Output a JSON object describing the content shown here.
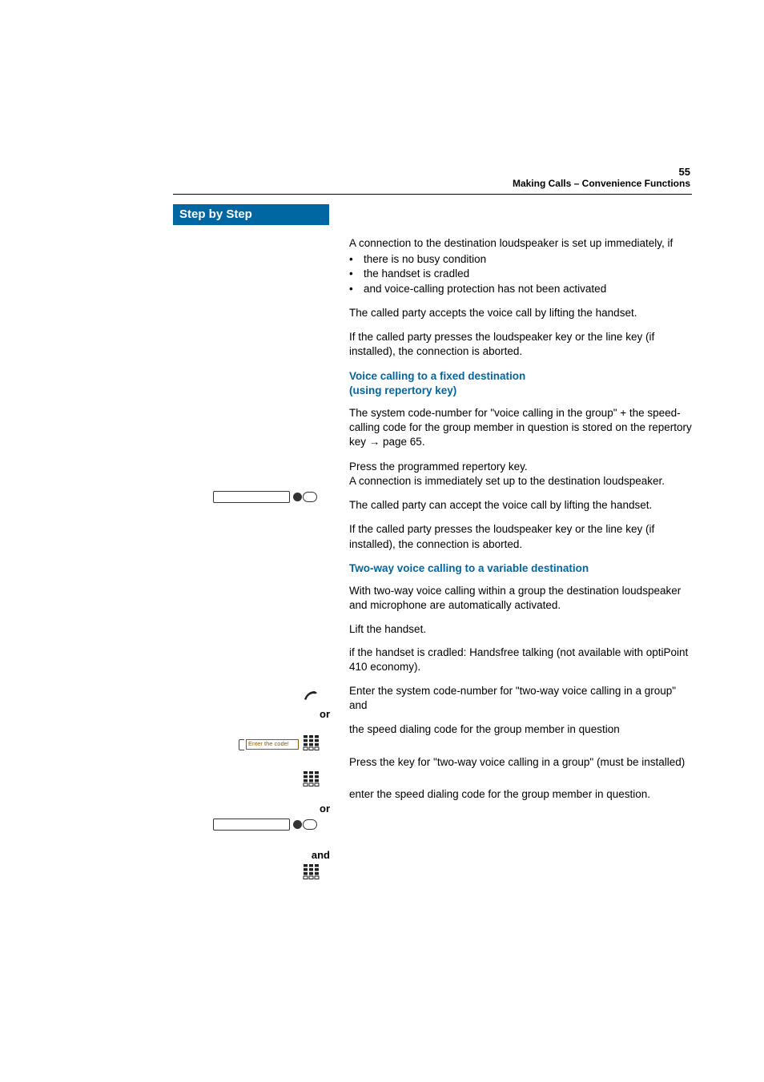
{
  "header": {
    "running_title": "Making Calls – Convenience Functions"
  },
  "sidebar": {
    "title": "Step by Step"
  },
  "intro": {
    "lead": "A connection to the destination loudspeaker is set up immediately, if",
    "bullets": [
      "there is no busy condition",
      "the handset is cradled",
      "and voice-calling protection has not been activated"
    ],
    "p2": "The called party accepts the voice call by lifting the handset.",
    "p3": "If the called party presses the loudspeaker key or the line key (if installed), the connection is aborted."
  },
  "section1": {
    "title_l1": "Voice calling to a fixed destination",
    "title_l2": "(using repertory key)",
    "p1_a": "The system code-number for \"voice calling in the group\" + the speed-calling code for the group member in question is stored on the repertory key ",
    "p1_link": "→ page 65",
    "p1_b": ".",
    "p2": "Press the programmed repertory key.\nA connection is immediately set up to the destination loudspeaker.",
    "p3": "The called party can accept the voice call by lifting the handset.",
    "p4": "If the called party presses the loudspeaker key or the line key (if installed), the connection is aborted."
  },
  "section2": {
    "title": "Two-way voice calling to a variable destination",
    "p1": "With two-way voice calling within a group the destination loudspeaker and microphone are automatically activated.",
    "lift": "Lift the handset.",
    "or1": "or",
    "or1_text": "if the handset is cradled: Handsfree talking (not available with optiPoint 410 economy).",
    "code_label": "Enter the code!",
    "code_text": "Enter the system code-number for \"two-way voice calling in a group\" and",
    "speed_text": "the speed dialing code for the group member in question",
    "or2": "or",
    "key_text": "Press the key for \"two-way voice calling in a group\" (must be installed)",
    "and": "and",
    "and_text": "enter the speed dialing code for the group member in question."
  },
  "page_number": "55"
}
